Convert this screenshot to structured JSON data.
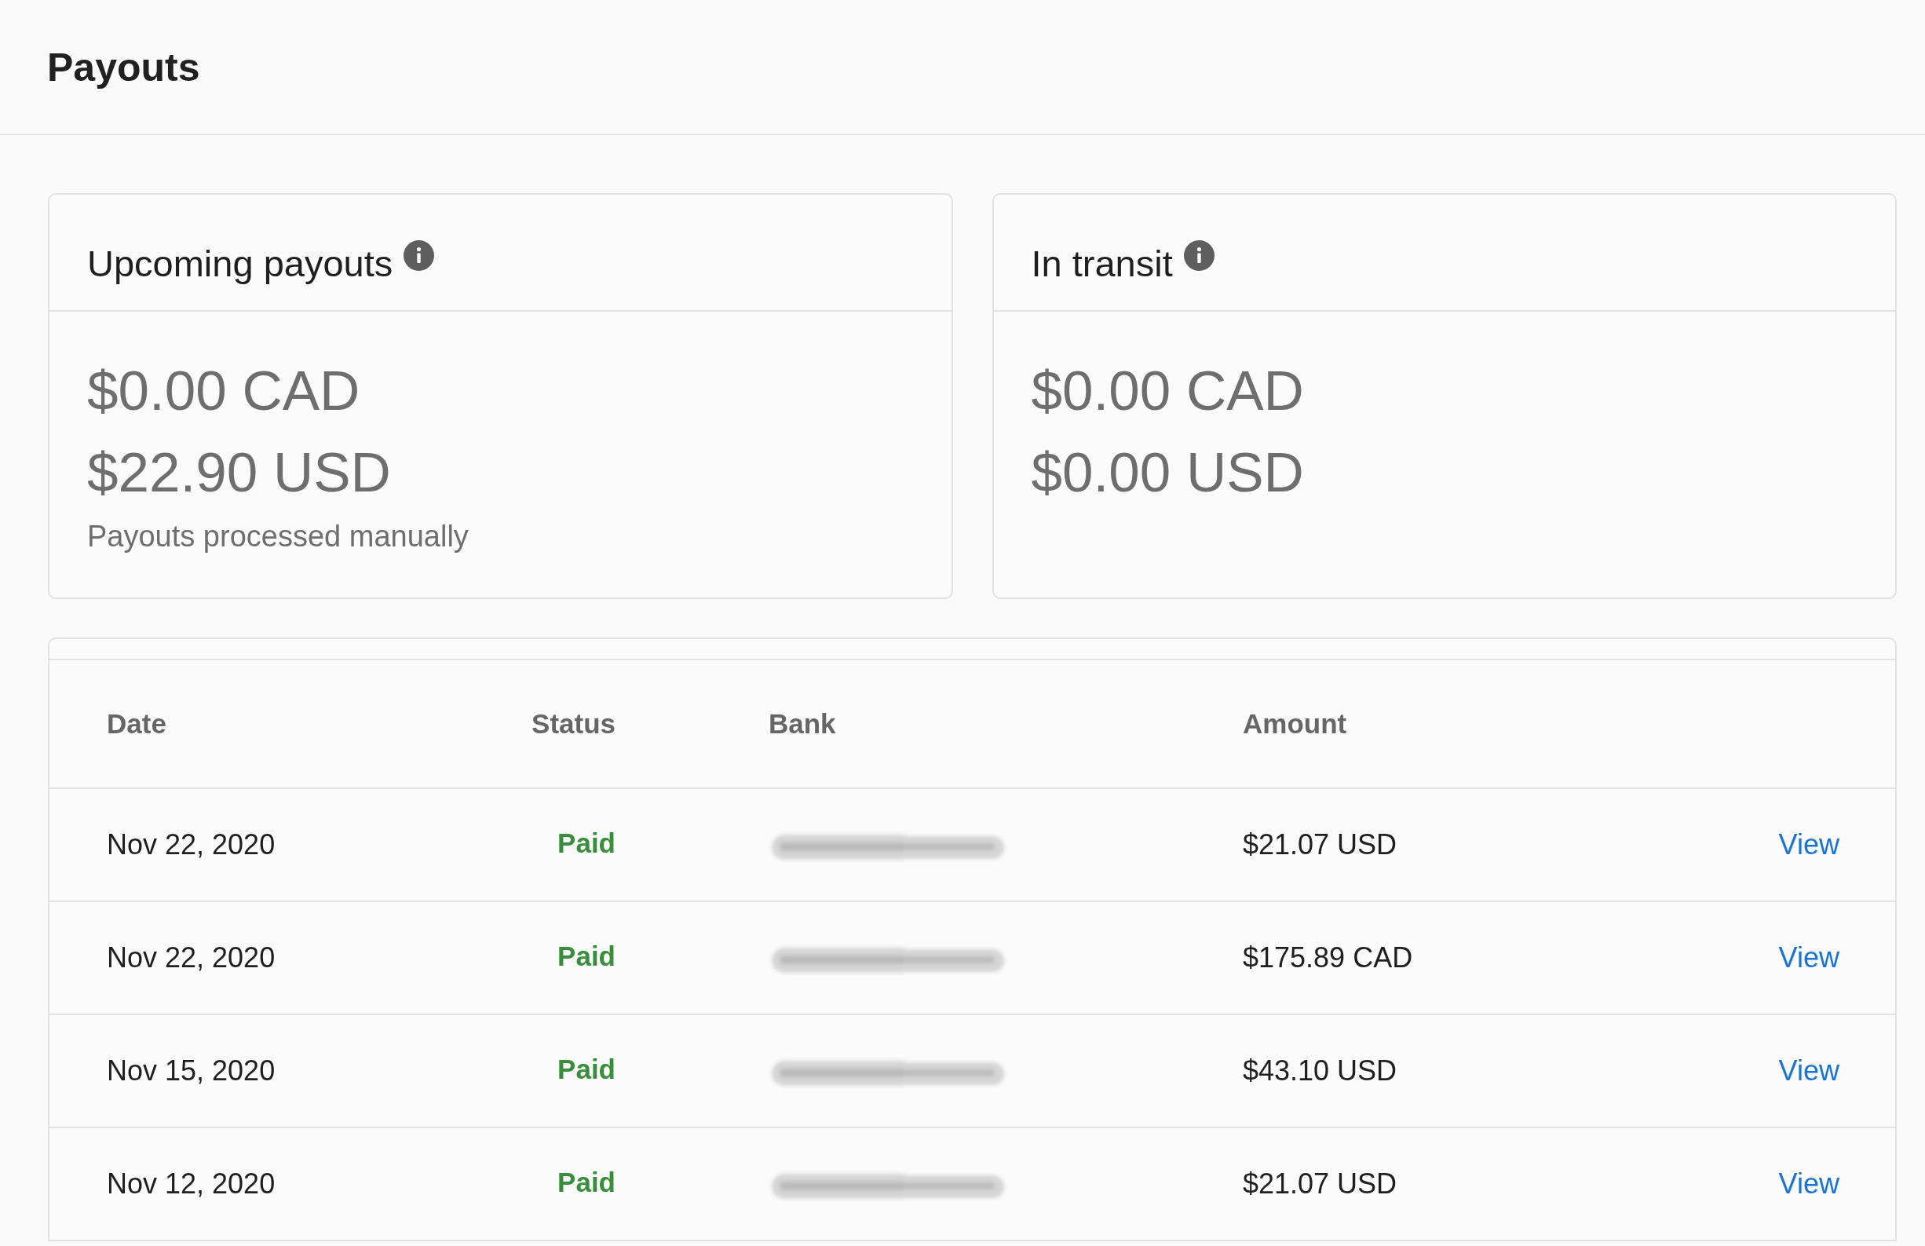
{
  "page": {
    "title": "Payouts"
  },
  "summary_cards": [
    {
      "title": "Upcoming payouts",
      "amounts": [
        "$0.00 CAD",
        "$22.90 USD"
      ],
      "note": "Payouts processed manually"
    },
    {
      "title": "In transit",
      "amounts": [
        "$0.00 CAD",
        "$0.00 USD"
      ]
    }
  ],
  "table": {
    "columns": [
      "Date",
      "Status",
      "Bank",
      "Amount"
    ],
    "rows": [
      {
        "date": "Nov 22, 2020",
        "status": "Paid",
        "bank_redacted": true,
        "amount": "$21.07 USD",
        "action": "View"
      },
      {
        "date": "Nov 22, 2020",
        "status": "Paid",
        "bank_redacted": true,
        "amount": "$175.89 CAD",
        "action": "View"
      },
      {
        "date": "Nov 15, 2020",
        "status": "Paid",
        "bank_redacted": true,
        "amount": "$43.10 USD",
        "action": "View"
      },
      {
        "date": "Nov 12, 2020",
        "status": "Paid",
        "bank_redacted": true,
        "amount": "$21.07 USD",
        "action": "View"
      }
    ]
  }
}
